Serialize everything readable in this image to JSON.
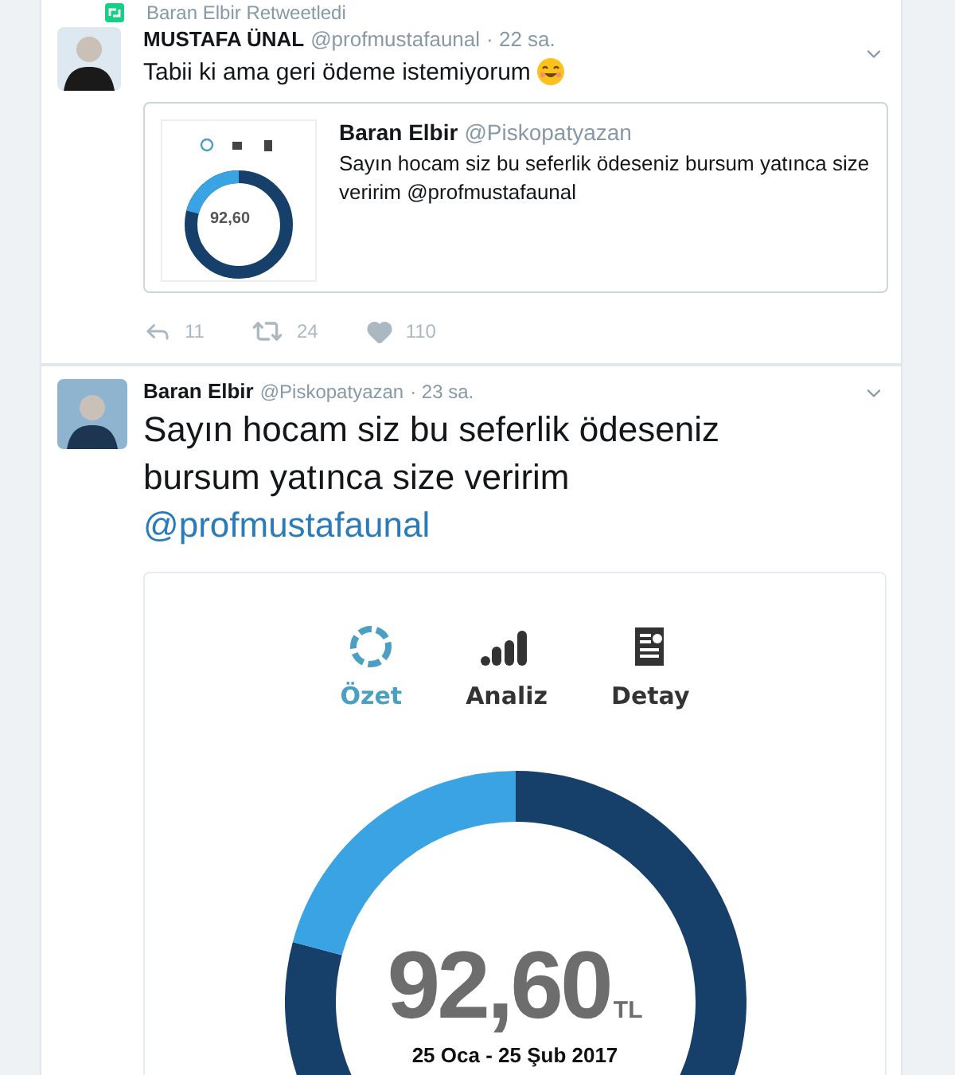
{
  "retweet_header": {
    "text": "Baran Elbir Retweetledi"
  },
  "tweets": [
    {
      "name": "MUSTAFA ÜNAL",
      "handle": "@profmustafaunal",
      "time": "· 22 sa.",
      "text": "Tabii ki ama geri ödeme istemiyorum",
      "quote": {
        "name": "Baran Elbir",
        "handle": "@Piskopatyazan",
        "text": "Sayın hocam siz bu seferlik ödeseniz bursum yatınca size veririm @profmustafaunal",
        "thumbnail_amount": "92,60"
      },
      "actions": [
        {
          "kind": "reply",
          "count": "11"
        },
        {
          "kind": "retweet",
          "count": "24"
        },
        {
          "kind": "like",
          "count": "110"
        }
      ]
    },
    {
      "name": "Baran Elbir",
      "handle": "@Piskopatyazan",
      "time": "· 23 sa.",
      "text": "Sayın hocam siz bu seferlik ödeseniz bursum yatınca size veririm",
      "mention": "@profmustafaunal",
      "media": {
        "tabs": [
          {
            "kind": "summary",
            "label": "Özet",
            "selected": true
          },
          {
            "kind": "analysis",
            "label": "Analiz",
            "selected": false
          },
          {
            "kind": "detail",
            "label": "Detay",
            "selected": false
          }
        ],
        "amount": "92,60",
        "currency": "TL",
        "period": "25 Oca - 25 Şub 2017"
      }
    }
  ]
}
